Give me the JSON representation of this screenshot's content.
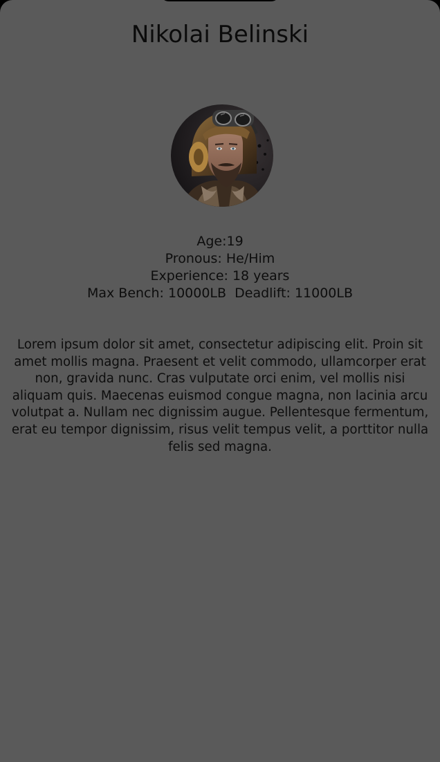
{
  "profile": {
    "name": "Nikolai Belinski",
    "avatar_icon": "aviator-portrait-photo",
    "stats": {
      "age": "Age:19",
      "pronouns": "Pronous: He/Him",
      "experience": "Experience: 18 years",
      "lifts": "Max Bench: 10000LB  Deadlift: 11000LB"
    },
    "bio": "Lorem ipsum dolor sit amet, consectetur adipiscing elit. Proin sit amet mollis magna. Praesent et velit commodo, ullamcorper erat non, gravida nunc. Cras vulputate orci enim, vel mollis nisi aliquam quis. Maecenas euismod congue magna, non lacinia arcu volutpat a. Nullam nec dignissim augue. Pellentesque fermentum, erat eu tempor dignissim, risus velit tempus velit, a porttitor nulla felis sed magna."
  },
  "colors": {
    "background": "#5a5a5a",
    "text": "#0d0d0d"
  }
}
